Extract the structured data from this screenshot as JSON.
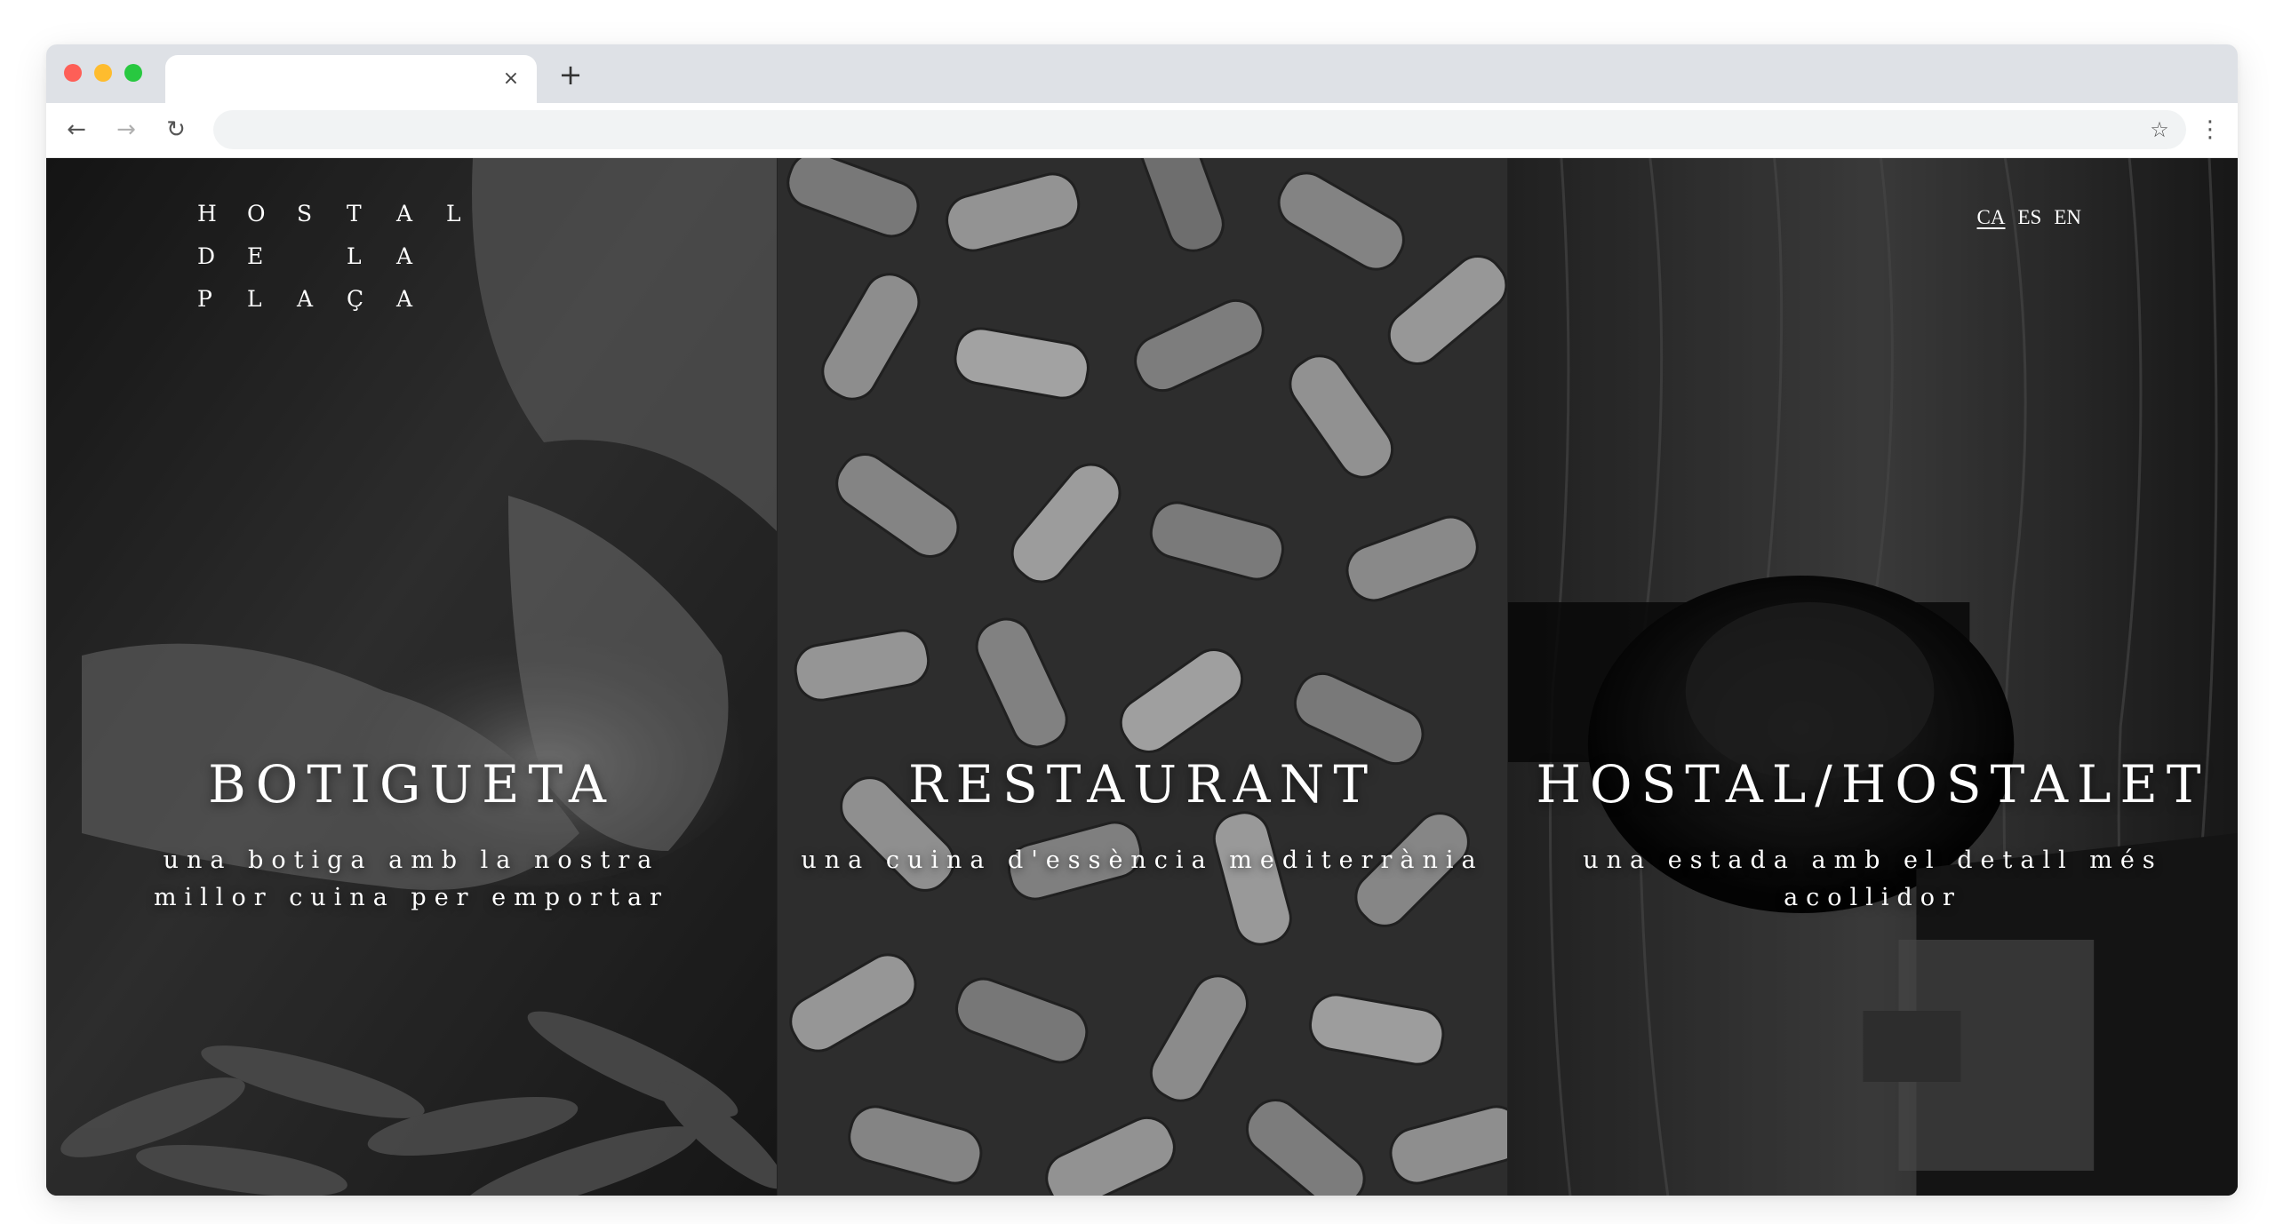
{
  "browser": {
    "tab": {
      "title": "",
      "close_icon": "close-icon",
      "close_glyph": "×"
    },
    "new_tab_glyph": "+",
    "nav": {
      "back": "←",
      "forward": "→",
      "reload": "↻"
    },
    "address": {
      "value": "",
      "placeholder": ""
    },
    "bookmark_glyph": "☆",
    "menu_glyph": "⋮",
    "traffic_lights": {
      "close": "#fe5f57",
      "minimize": "#febc2e",
      "maximize": "#28c840"
    }
  },
  "site": {
    "logo": [
      [
        "H",
        "O",
        "S",
        "T",
        "A",
        "L"
      ],
      [
        "D",
        "E",
        "",
        "L",
        "A"
      ],
      [
        "P",
        "L",
        "A",
        "Ç",
        "A"
      ]
    ],
    "languages": [
      {
        "label": "CA",
        "active": true
      },
      {
        "label": "ES",
        "active": false
      },
      {
        "label": "EN",
        "active": false
      }
    ],
    "panels": [
      {
        "title": "BOTIGUETA",
        "subtitle": "una botiga amb la nostra millor cuina per emportar",
        "image": "hands-with-peas-photo"
      },
      {
        "title": "RESTAURANT",
        "subtitle": "una cuina d'essència mediterrània",
        "image": "wine-corks-photo"
      },
      {
        "title": "HOSTAL/HOSTALET",
        "subtitle": "una estada amb el detall més acollidor",
        "image": "door-handle-photo"
      }
    ]
  }
}
